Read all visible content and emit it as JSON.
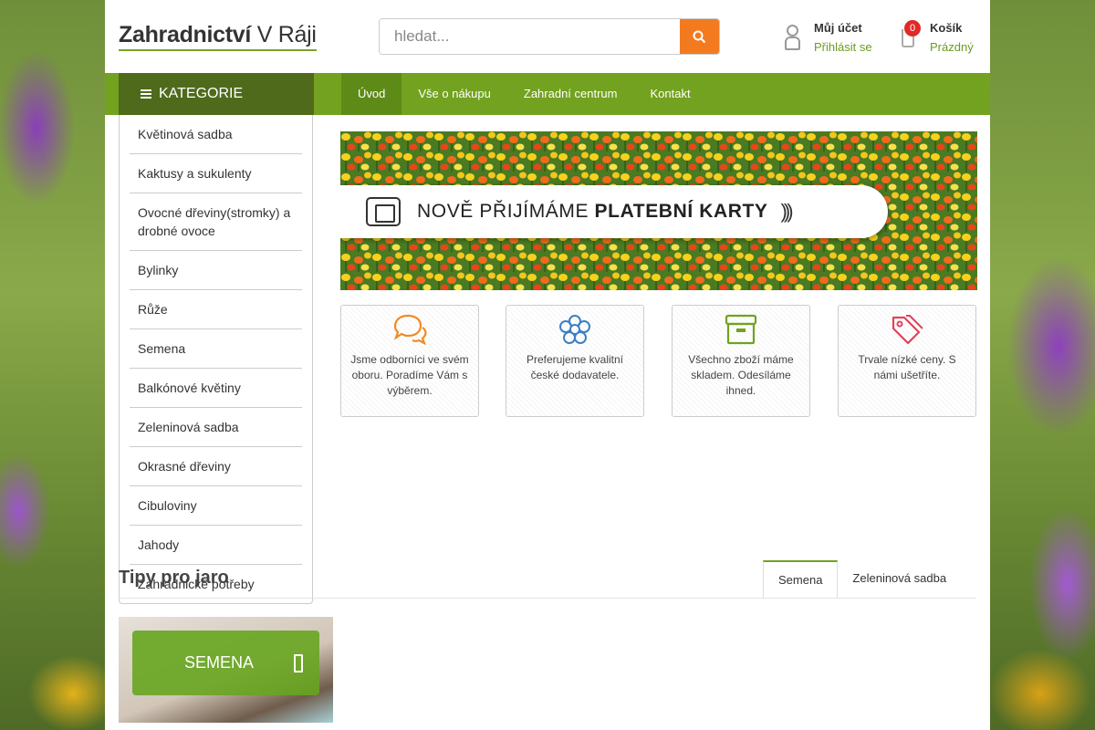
{
  "header": {
    "logo_bold": "Zahradnictví",
    "logo_rest": " V Ráji",
    "search_placeholder": "hledat...",
    "search_icon": "search-icon",
    "account_title": "Můj účet",
    "account_link": "Přihlásit se",
    "cart_title": "Košík",
    "cart_status": "Prázdný",
    "cart_count": "0"
  },
  "nav": {
    "categories_label": "KATEGORIE",
    "items": [
      {
        "label": "Úvod"
      },
      {
        "label": "Vše o nákupu"
      },
      {
        "label": "Zahradní centrum"
      },
      {
        "label": "Kontakt"
      }
    ]
  },
  "sidebar": {
    "items": [
      {
        "label": "Květinová sadba"
      },
      {
        "label": "Kaktusy a sukulenty"
      },
      {
        "label": "Ovocné dřeviny(stromky) a drobné ovoce"
      },
      {
        "label": "Bylinky"
      },
      {
        "label": "Růže"
      },
      {
        "label": "Semena"
      },
      {
        "label": "Balkónové květiny"
      },
      {
        "label": "Zeleninová sadba"
      },
      {
        "label": "Okrasné dřeviny"
      },
      {
        "label": "Cibuloviny"
      },
      {
        "label": "Jahody"
      },
      {
        "label": "Zahradnické potřeby"
      }
    ]
  },
  "banner": {
    "text_normal": "NOVĚ PŘIJÍMÁME ",
    "text_bold": "PLATEBNÍ KARTY"
  },
  "features": [
    {
      "icon": "chat-bubbles-icon",
      "color": "#f08a24",
      "text": "Jsme odborníci ve svém oboru. Poradíme Vám s výběrem."
    },
    {
      "icon": "flower-icon",
      "color": "#3b7fc4",
      "text": "Preferujeme kvalitní české dodavatele."
    },
    {
      "icon": "archive-box-icon",
      "color": "#72a21f",
      "text": "Všechno zboží máme skladem. Odesíláme ihned."
    },
    {
      "icon": "price-tag-icon",
      "color": "#e0445a",
      "text": "Trvale nízké ceny. S námi ušetříte."
    }
  ],
  "section": {
    "title": "Tipy pro jaro",
    "tabs": [
      {
        "label": "Semena"
      },
      {
        "label": "Zeleninová sadba"
      }
    ]
  },
  "category_card": {
    "label": "SEMENA"
  },
  "colors": {
    "brand_green": "#72a21f",
    "dark_green": "#4f6a1b",
    "search_orange": "#f47a20",
    "badge_red": "#e02a2a"
  }
}
